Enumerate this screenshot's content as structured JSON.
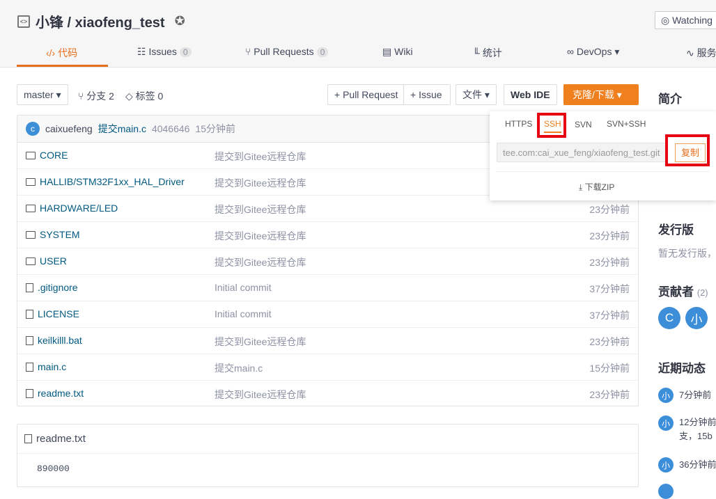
{
  "header": {
    "title": "小锋 / xiaofeng_test",
    "watch": "Watching"
  },
  "nav": [
    {
      "label": "代码"
    },
    {
      "label": "Issues",
      "badge": "0"
    },
    {
      "label": "Pull Requests",
      "badge": "0"
    },
    {
      "label": "Wiki"
    },
    {
      "label": "统计"
    },
    {
      "label": "DevOps"
    },
    {
      "label": "服务"
    }
  ],
  "toolbar": {
    "branch": "master",
    "branches": "分支 2",
    "tags": "标签 0",
    "pull_request": "+ Pull Request",
    "issue": "+ Issue",
    "files": "文件",
    "webide": "Web IDE",
    "clone": "克隆/下载"
  },
  "commit": {
    "avatar": "c",
    "author": "caixuefeng",
    "message": "提交main.c",
    "hash": "4046646",
    "time": "15分钟前"
  },
  "files": [
    {
      "name": "CORE",
      "type": "folder",
      "msg": "提交到Gitee远程仓库",
      "time": ""
    },
    {
      "name": "HALLIB/STM32F1xx_HAL_Driver",
      "type": "folder",
      "msg": "提交到Gitee远程仓库",
      "time": ""
    },
    {
      "name": "HARDWARE/LED",
      "type": "folder",
      "msg": "提交到Gitee远程仓库",
      "time": "23分钟前"
    },
    {
      "name": "SYSTEM",
      "type": "folder",
      "msg": "提交到Gitee远程仓库",
      "time": "23分钟前"
    },
    {
      "name": "USER",
      "type": "folder",
      "msg": "提交到Gitee远程仓库",
      "time": "23分钟前"
    },
    {
      "name": ".gitignore",
      "type": "file",
      "msg": "Initial commit",
      "time": "37分钟前"
    },
    {
      "name": "LICENSE",
      "type": "file",
      "msg": "Initial commit",
      "time": "37分钟前"
    },
    {
      "name": "keilkilll.bat",
      "type": "file",
      "msg": "提交到Gitee远程仓库",
      "time": "23分钟前"
    },
    {
      "name": "main.c",
      "type": "file",
      "msg": "提交main.c",
      "time": "15分钟前"
    },
    {
      "name": "readme.txt",
      "type": "file",
      "msg": "提交到Gitee远程仓库",
      "time": "23分钟前"
    }
  ],
  "readme": {
    "title": "readme.txt",
    "content": "890000"
  },
  "clone_dropdown": {
    "tabs": [
      "HTTPS",
      "SSH",
      "SVN",
      "SVN+SSH"
    ],
    "active": "SSH",
    "url": "tee.com:cai_xue_feng/xiaofeng_test.git",
    "copy": "复制",
    "zip": "下载ZIP"
  },
  "sidebar": {
    "intro": "简介",
    "release": "发行版",
    "release_text": "暂无发行版，",
    "contributors": "贡献者",
    "contrib_count": "(2)",
    "contrib_avatars": [
      "C",
      "小"
    ],
    "activity": "近期动态",
    "activities": [
      {
        "avatar": "小",
        "text": "7分钟前"
      },
      {
        "avatar": "小",
        "text": "12分钟前",
        "text2": "支，15b"
      },
      {
        "avatar": "小",
        "text": "36分钟前"
      }
    ]
  },
  "colors": {
    "accent": "#f07f1d",
    "highlight": "#e60012",
    "link": "#005980"
  }
}
